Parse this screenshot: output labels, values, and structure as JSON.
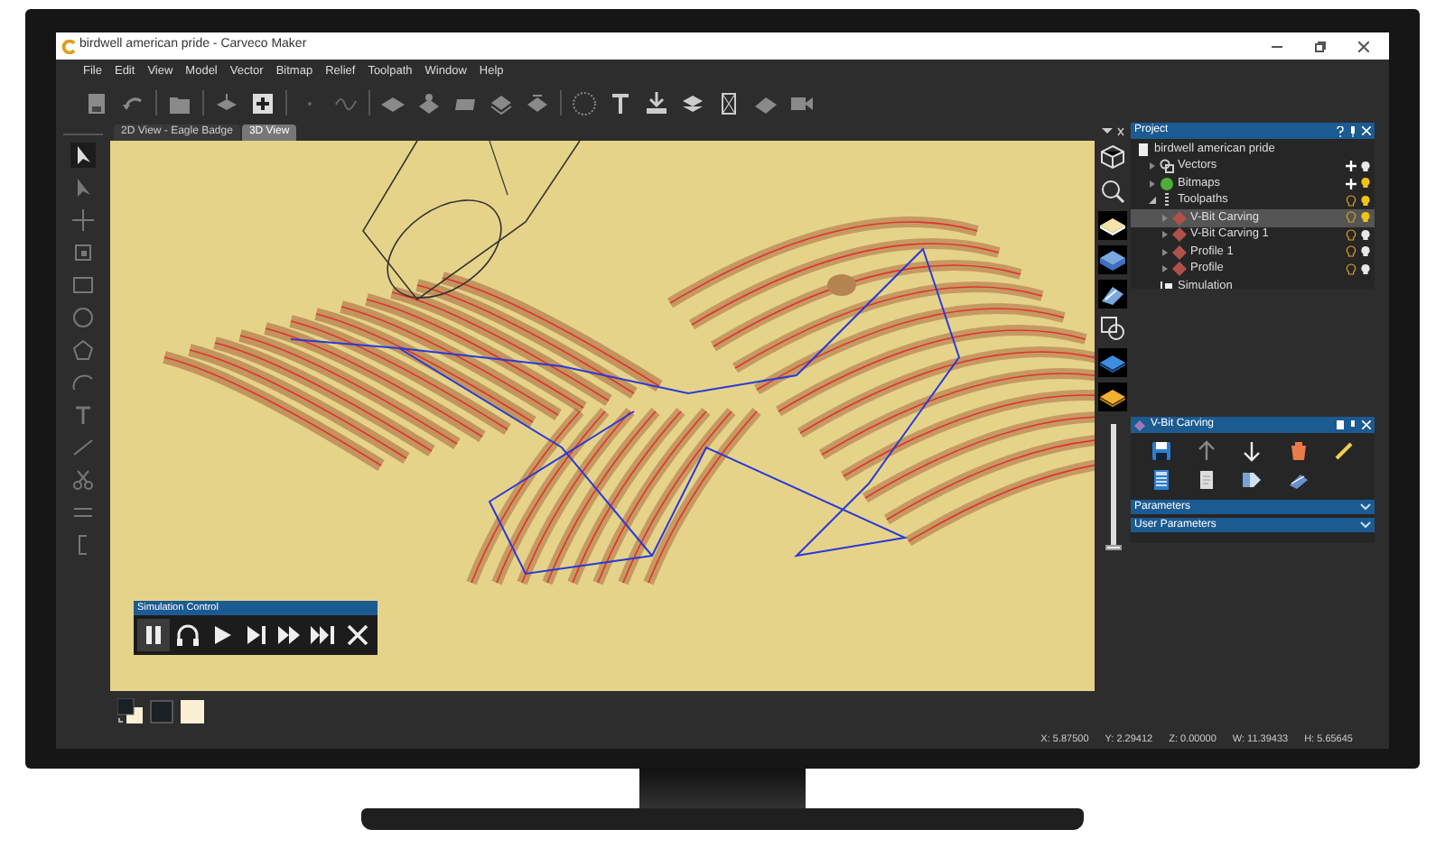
{
  "window": {
    "title": "birdwell american pride - Carveco Maker"
  },
  "menu": [
    "File",
    "Edit",
    "View",
    "Model",
    "Vector",
    "Bitmap",
    "Relief",
    "Toolpath",
    "Window",
    "Help"
  ],
  "tabs": [
    {
      "label": "2D View - Eagle Badge",
      "selected": false
    },
    {
      "label": "3D View",
      "selected": true
    }
  ],
  "simulation_control": {
    "title": "Simulation Control",
    "buttons": [
      {
        "kind": "pause",
        "selected": true
      },
      {
        "kind": "rewind",
        "selected": false
      },
      {
        "kind": "play",
        "selected": false
      },
      {
        "kind": "step",
        "selected": false
      },
      {
        "kind": "fast",
        "selected": false
      },
      {
        "kind": "end",
        "selected": false
      },
      {
        "kind": "close",
        "selected": false
      }
    ]
  },
  "project_panel": {
    "title": "Project",
    "tree": [
      {
        "label": "birdwell american pride",
        "kind": "document",
        "selected": false,
        "children": [
          {
            "label": "Vectors",
            "kind": "vectors",
            "expanded": false,
            "selected": false,
            "visible": false
          },
          {
            "label": "Bitmaps",
            "kind": "bitmaps",
            "expanded": false,
            "selected": false,
            "visible": true
          },
          {
            "label": "Toolpaths",
            "kind": "toolpaths",
            "expanded": true,
            "selected": false,
            "visible": true,
            "children": [
              {
                "label": "V-Bit Carving",
                "kind": "toolpath",
                "expanded": false,
                "selected": true,
                "visible": true
              },
              {
                "label": "V-Bit Carving 1",
                "kind": "toolpath",
                "expanded": false,
                "selected": false,
                "visible": false
              },
              {
                "label": "Profile 1",
                "kind": "toolpath",
                "expanded": false,
                "selected": false,
                "visible": false
              },
              {
                "label": "Profile",
                "kind": "toolpath",
                "expanded": false,
                "selected": false,
                "visible": false
              }
            ]
          },
          {
            "label": "Simulation",
            "kind": "simulation",
            "selected": false
          }
        ]
      }
    ]
  },
  "toolpath_panel": {
    "title": "V-Bit Carving",
    "sections": [
      {
        "label": "Parameters",
        "expanded": false
      },
      {
        "label": "User Parameters",
        "expanded": false
      }
    ]
  },
  "zoom_slider": {
    "level": 0
  },
  "status_bar": [
    "X: 5.87500",
    "Y: 2.29412",
    "Z: 0.00000",
    "W: 11.39433",
    "H: 5.65645"
  ]
}
